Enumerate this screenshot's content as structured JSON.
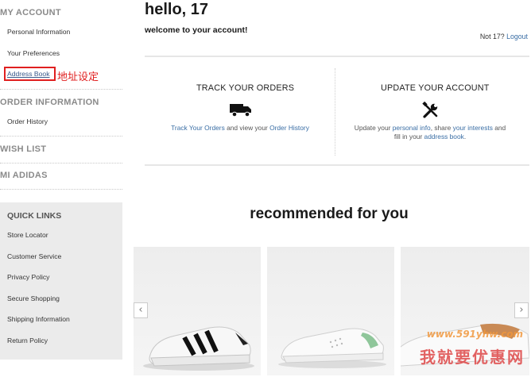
{
  "sidebar": {
    "my_account": {
      "heading": "MY ACCOUNT",
      "items": [
        "Personal Information",
        "Your Preferences",
        "Address Book"
      ]
    },
    "annotation": "地址设定",
    "order_information": {
      "heading": "ORDER INFORMATION",
      "items": [
        "Order History"
      ]
    },
    "wish_list": "WISH LIST",
    "mi_adidas": "MI ADIDAS",
    "quick_links": {
      "heading": "QUICK LINKS",
      "items": [
        "Store Locator",
        "Customer Service",
        "Privacy Policy",
        "Secure Shopping",
        "Shipping Information",
        "Return Policy"
      ]
    }
  },
  "header": {
    "greeting": "hello, 17",
    "welcome": "welcome to your account!",
    "not_user_prefix": "Not 17?",
    "logout": "Logout"
  },
  "panels": {
    "track": {
      "title": "TRACK YOUR ORDERS",
      "icon": "truck-icon",
      "link1": "Track Your Orders",
      "mid": " and view your ",
      "link2": "Order History"
    },
    "update": {
      "title": "UPDATE YOUR ACCOUNT",
      "icon": "tools-icon",
      "prefix": "Update your ",
      "link1": "personal info",
      "mid1": ", share ",
      "link2": "your interests",
      "mid2": " and",
      "line2_prefix": "fill in your ",
      "link3": "address book",
      "suffix": "."
    }
  },
  "recommended": {
    "title": "recommended for you",
    "prev": "‹",
    "next": "›"
  },
  "watermark": {
    "site": "www.591yhw.com",
    "text": "我就要优惠网"
  },
  "colors": {
    "link": "#3a6ea5",
    "annotation": "#e02020",
    "quick_links_bg": "#ebebeb"
  }
}
